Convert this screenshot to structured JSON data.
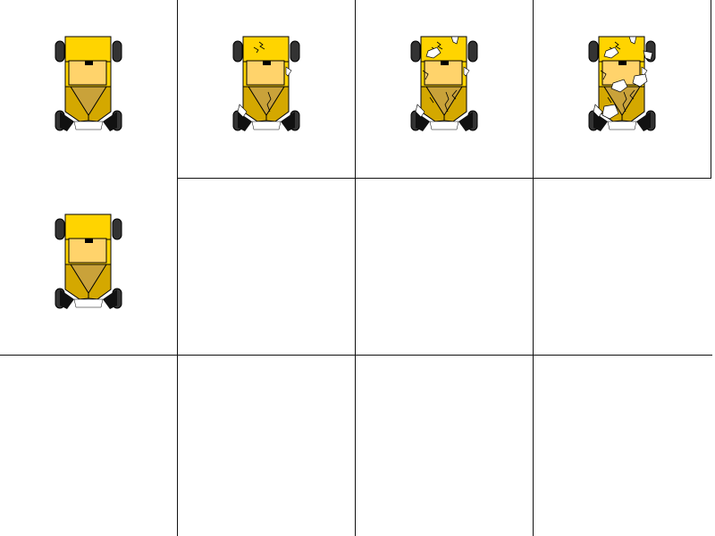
{
  "sprite_sheet": {
    "columns": 4,
    "rows": 3,
    "colors": {
      "background": "#ffffff",
      "grid_line": "#111111",
      "body_yellow": "#ffd400",
      "body_gold": "#d4a800",
      "cockpit_tan": "#ffd36b",
      "cone_brown": "#c9a23a",
      "wheel_dark": "#333333",
      "fin_black": "#111111",
      "crack_white": "#ffffff"
    },
    "sprites": [
      {
        "id": "buggy-intact",
        "damage_stage": 0,
        "cell": [
          0,
          0
        ]
      },
      {
        "id": "buggy-damage-1",
        "damage_stage": 1,
        "cell": [
          1,
          0
        ]
      },
      {
        "id": "buggy-damage-2",
        "damage_stage": 2,
        "cell": [
          2,
          0
        ]
      },
      {
        "id": "buggy-damage-3",
        "damage_stage": 3,
        "cell": [
          3,
          0
        ]
      },
      {
        "id": "buggy-intact-alt",
        "damage_stage": 0,
        "cell": [
          0,
          1
        ]
      }
    ],
    "empty_cells": [
      [
        1,
        1
      ],
      [
        2,
        1
      ],
      [
        3,
        1
      ],
      [
        0,
        2
      ],
      [
        1,
        2
      ],
      [
        2,
        2
      ],
      [
        3,
        2
      ]
    ]
  }
}
